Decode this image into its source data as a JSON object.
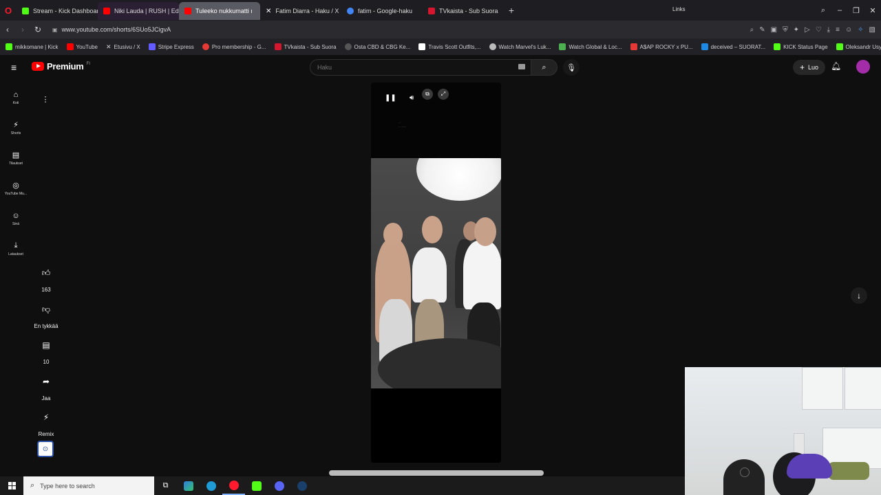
{
  "browser": {
    "tabs": [
      {
        "title": "Stream - Kick Dashboard",
        "favicon_color": "#53fc18"
      },
      {
        "title": "Niki Lauda | RUSH | Edit | +",
        "favicon_color": "#ff0000"
      },
      {
        "title": "Tuleeko nukkumatti ı",
        "favicon_color": "#ff0000",
        "active": true
      },
      {
        "title": "Fatim Diarra - Haku / X",
        "favicon_color": "#ffffff"
      },
      {
        "title": "fatim - Google-haku",
        "favicon_color": "#4285f4"
      },
      {
        "title": "TVkaista - Sub Suora",
        "favicon_color": "#d4162f"
      }
    ],
    "new_tab": "+",
    "url": "www.youtube.com/shorts/6SUo5JCigvA",
    "bookmarks": [
      {
        "label": "mikkomane | Kick",
        "color": "#53fc18"
      },
      {
        "label": "YouTube",
        "color": "#ff0000"
      },
      {
        "label": "Etusivu / X",
        "color": "#ffffff"
      },
      {
        "label": "Stripe Express",
        "color": "#635bff"
      },
      {
        "label": "Pro membership - G...",
        "color": "#e53935"
      },
      {
        "label": "TVkaista - Sub Suora",
        "color": "#d4162f"
      },
      {
        "label": "Osta CBD & CBG Ke...",
        "color": "#555555"
      },
      {
        "label": "Travis Scott Outfits,...",
        "color": "#ffffff"
      },
      {
        "label": "Watch Marvel's Luk...",
        "color": "#bbbbbb"
      },
      {
        "label": "Watch Global & Loc...",
        "color": "#4caf50"
      },
      {
        "label": "A$AP ROCKY x PU...",
        "color": "#e53935"
      },
      {
        "label": "deceived – SUORAT...",
        "color": "#1e88e5"
      },
      {
        "label": "KICK Status Page",
        "color": "#53fc18"
      },
      {
        "label": "Oleksandr Usyk vs D...",
        "color": "#53fc18"
      }
    ]
  },
  "youtube": {
    "logo_text": "Premium",
    "country_code": "FI",
    "search_placeholder": "Haku",
    "create_label": "Luo",
    "guide": [
      {
        "label": "Koti",
        "icon": "home-icon",
        "glyph": "⌂"
      },
      {
        "label": "Shorts",
        "icon": "shorts-icon",
        "glyph": "⚡"
      },
      {
        "label": "Tilaukset",
        "icon": "subscriptions-icon",
        "glyph": "▤"
      },
      {
        "label": "YouTube Mu...",
        "icon": "music-icon",
        "glyph": "◎"
      },
      {
        "label": "Sinä",
        "icon": "you-icon",
        "glyph": "☺"
      },
      {
        "label": "Lataukset",
        "icon": "downloads-icon",
        "glyph": "⤓"
      }
    ],
    "actions": {
      "like_count": "163",
      "dislike_label": "En tykkää",
      "comments_count": "10",
      "share_label": "Jaa",
      "remix_label": "Remix"
    }
  },
  "taskbar": {
    "search_placeholder": "Type here to search",
    "links_label": "Links"
  }
}
